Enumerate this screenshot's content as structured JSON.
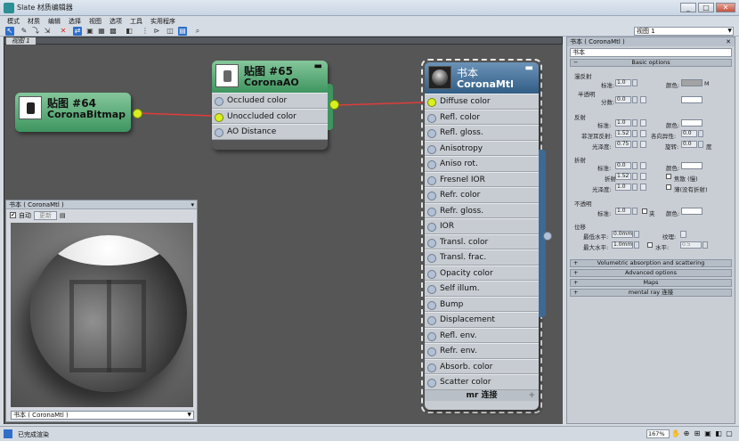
{
  "window": {
    "title": "Slate 材质编辑器",
    "min": "_",
    "max": "□",
    "close": "✕"
  },
  "menu": [
    "模式",
    "材质",
    "编辑",
    "选择",
    "视图",
    "选项",
    "工具",
    "实用程序"
  ],
  "toolbar": {
    "view_select": "视图 1"
  },
  "tab": {
    "label": "视图 1"
  },
  "nodes": {
    "bitmap": {
      "title": "贴图 #64",
      "type": "CoronaBitmap"
    },
    "ao": {
      "title": "贴图 #65",
      "type": "CoronaAO",
      "slots": [
        "Occluded color",
        "Unoccluded color",
        "AO Distance"
      ]
    },
    "mtl": {
      "title": "书本",
      "type": "CoronaMtl",
      "slots": [
        "Diffuse color",
        "Refl. color",
        "Refl. gloss.",
        "Anisotropy",
        "Aniso rot.",
        "Fresnel IOR",
        "Refr. color",
        "Refr. gloss.",
        "IOR",
        "Transl. color",
        "Transl. frac.",
        "Opacity color",
        "Self illum.",
        "Bump",
        "Displacement",
        "Refl. env.",
        "Refr. env.",
        "Absorb. color",
        "Scatter color"
      ],
      "footer": "mr 连接"
    }
  },
  "preview": {
    "title": "书本 ( CoronaMtl )",
    "auto_label": "自动",
    "update_label": "更新",
    "select_value": "书本 ( CoronaMtl )"
  },
  "right_panel": {
    "title": "书本 ( CoronaMtl )",
    "name_value": "书本",
    "rollout_basic": "Basic options",
    "diffuse": {
      "group": "漫反射",
      "level_label": "标准:",
      "level": "1.0",
      "color_label": "颜色:",
      "m": "M",
      "translucency": "半透明",
      "fraction_label": "分数:",
      "fraction": "0.0"
    },
    "reflection": {
      "group": "反射",
      "level_label": "标准:",
      "level": "1.0",
      "color_label": "颜色:",
      "fresnel_label": "菲涅耳反射:",
      "fresnel": "1.52",
      "aniso_label": "各向异性:",
      "aniso": "0.0",
      "gloss_label": "光泽度:",
      "gloss": "0.75",
      "rot_label": "旋转:",
      "rot": "0.0",
      "deg": "度"
    },
    "refraction": {
      "group": "折射",
      "level_label": "标准:",
      "level": "0.0",
      "color_label": "颜色:",
      "ior_label": "折射",
      "ior": "1.52",
      "caustics": "焦散 (慢)",
      "gloss_label": "光泽度:",
      "gloss": "1.0",
      "thin": "薄(没有折射)"
    },
    "opacity": {
      "group": "不透明",
      "level_label": "标准:",
      "level": "1.0",
      "clip": "夹",
      "color_label": "颜色:"
    },
    "displacement": {
      "group": "位移",
      "min_label": "最低水平:",
      "min": "0.0mm",
      "tex_label": "纹理:",
      "max_label": "最大水平:",
      "max": "1.0mm",
      "water_label": "水平:",
      "water": "0.5"
    },
    "rollouts": [
      "Volumetric absorption and scattering",
      "Advanced options",
      "Maps",
      "mental ray 连接"
    ]
  },
  "status": {
    "text": "已完成渲染",
    "zoom": "167%"
  },
  "colors": {
    "graph_bg": "#565656",
    "link": "#e03c3c",
    "pin_active": "#d9f01c",
    "node_green": "#4fa26c",
    "node_blue": "#3d6a94"
  }
}
